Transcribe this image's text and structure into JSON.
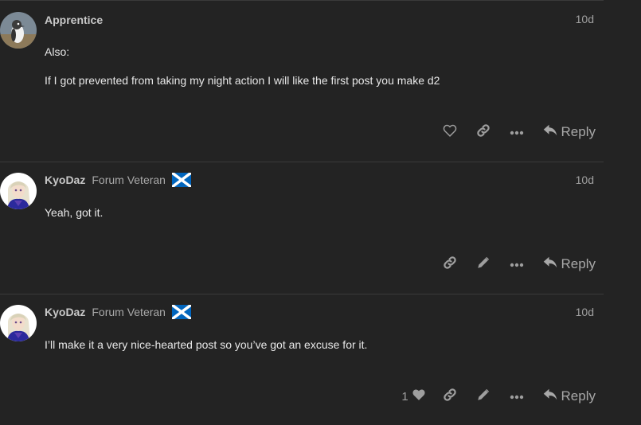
{
  "posts": [
    {
      "username": "Apprentice",
      "user_title": "",
      "date": "10d",
      "paragraphs": [
        "Also:",
        "If I got prevented from taking my night action I will like the first post you make d2"
      ],
      "like_count": "",
      "reply_label": "Reply"
    },
    {
      "username": "KyoDaz",
      "user_title": "Forum Veteran",
      "date": "10d",
      "paragraphs": [
        "Yeah, got it."
      ],
      "like_count": "",
      "reply_label": "Reply"
    },
    {
      "username": "KyoDaz",
      "user_title": "Forum Veteran",
      "date": "10d",
      "paragraphs": [
        "I’ll make it a very nice-hearted post so you’ve got an excuse for it."
      ],
      "like_count": "1",
      "reply_label": "Reply"
    }
  ],
  "icons": {
    "like": "heart-outline-icon",
    "liked": "heart-filled-icon",
    "link": "link-icon",
    "edit": "pencil-icon",
    "more": "ellipsis-icon",
    "reply": "reply-arrow-icon",
    "flag": "scotland-flag-icon"
  },
  "colors": {
    "background": "#232323",
    "divider": "#3a3a3a",
    "text": "#e8e8e8",
    "muted": "#9e9e9e",
    "flag_blue": "#0065bd"
  }
}
